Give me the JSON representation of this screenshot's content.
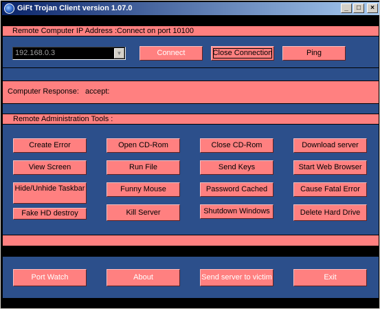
{
  "window": {
    "title": "GiFt Trojan Client version 1.07.0",
    "controls": {
      "minimize": "_",
      "maximize": "□",
      "close": "×"
    }
  },
  "connection": {
    "header": "Remote Computer IP Address :Connect on port 10100",
    "ip_value": "192.168.0.3",
    "connect_label": "Connect",
    "close_connection_label": "Close Connection",
    "ping_label": "Ping"
  },
  "response": {
    "label": "Computer Response:",
    "value": "accept:"
  },
  "tools": {
    "header": "Remote Administration Tools :",
    "buttons": [
      "Create Error",
      "Open CD-Rom",
      "Close CD-Rom",
      "Download server",
      "View Screen",
      "Run File",
      "Send Keys",
      "Start Web Browser",
      "Hide/Unhide Taskbar",
      "Funny Mouse",
      "Password Cached",
      "Cause Fatal Error",
      "Fake HD destroy",
      "Kill Server",
      "Shutdown Windows",
      "Delete Hard Drive"
    ]
  },
  "footer": {
    "port_watch": "Port Watch",
    "about": "About",
    "send_server": "Send server to victim",
    "exit": "Exit"
  },
  "colors": {
    "panel": "#2c4f8b",
    "accent": "#ff8080",
    "background": "#000000"
  }
}
